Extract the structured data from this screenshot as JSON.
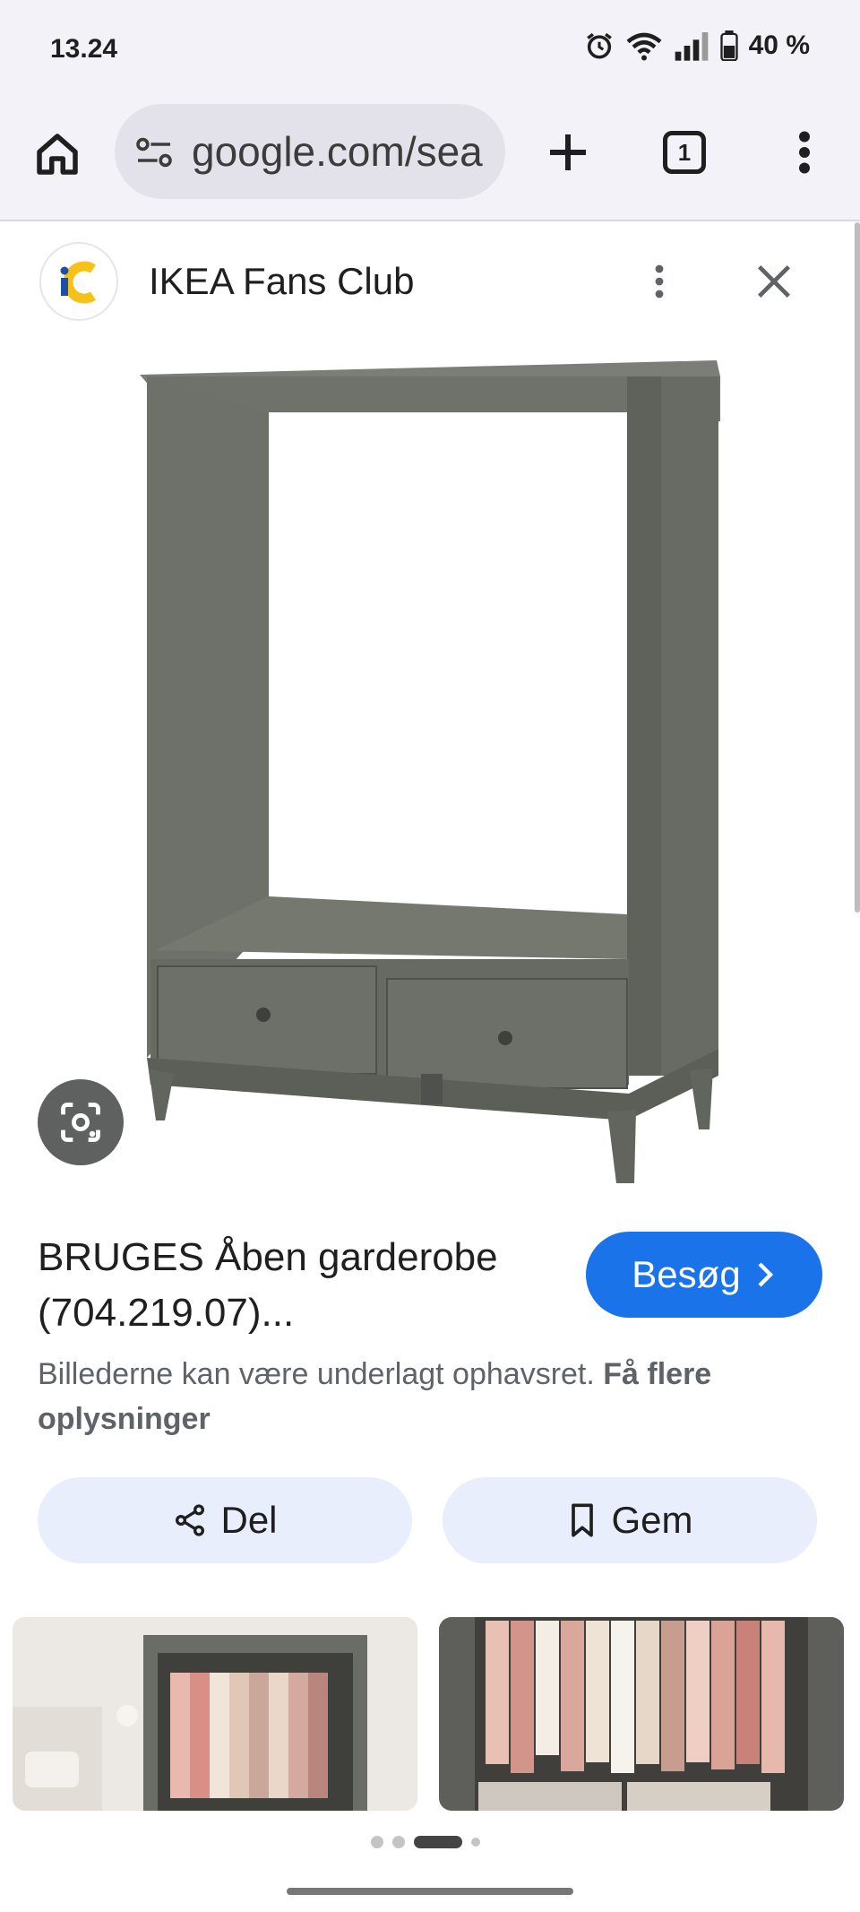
{
  "status_bar": {
    "time": "13.24",
    "battery": "40 %",
    "icons": [
      "alarm-icon",
      "wifi-icon",
      "signal-icon",
      "battery-icon"
    ]
  },
  "toolbar": {
    "url": "google.com/sea",
    "tab_count": "1",
    "icons": [
      "home-icon",
      "site-settings-icon",
      "plus-icon",
      "tabs-icon",
      "more-vert-icon"
    ]
  },
  "source": {
    "site_name": "IKEA Fans Club",
    "logo_text": "iC"
  },
  "product": {
    "title": "BRUGES Åben garderobe (704.219.07)...",
    "visit_label": "Besøg",
    "copyright_text": "Billederne kan være underlagt ophavsret.",
    "copyright_link": "Få flere oplysninger"
  },
  "actions": {
    "share_label": "Del",
    "save_label": "Gem"
  },
  "colors": {
    "accent": "#1a73e8",
    "chip_bg": "#e8eefb",
    "furniture": "#6c6f68"
  },
  "carousel": {
    "active_index": 2,
    "count": 4
  }
}
